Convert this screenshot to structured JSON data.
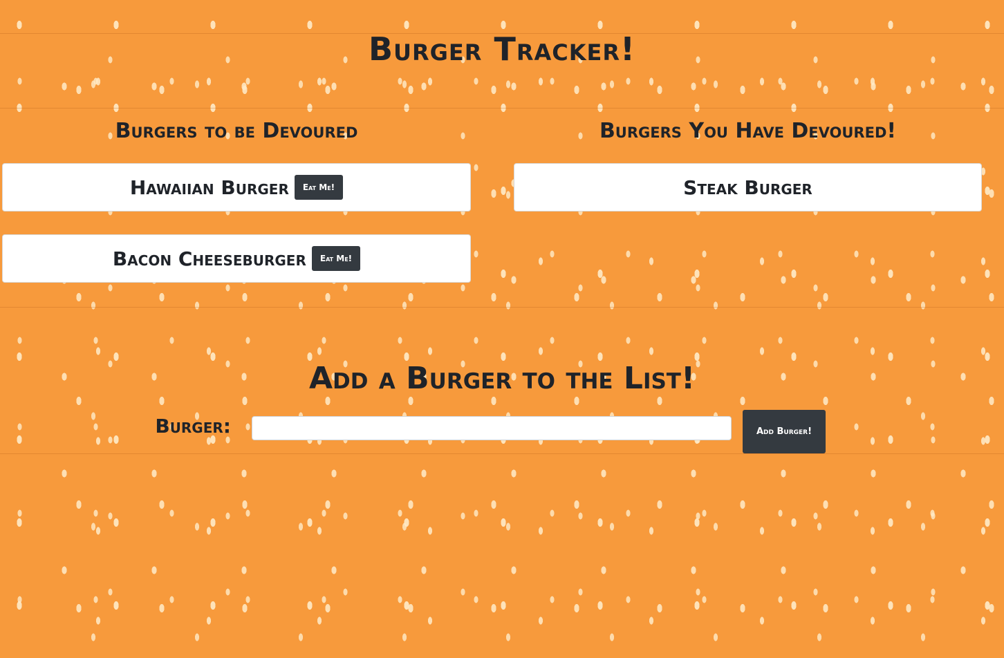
{
  "header": {
    "title": "Burger Tracker!"
  },
  "to_devour": {
    "heading": "Burgers to be Devoured",
    "items": [
      {
        "name": "Hawaiian Burger",
        "button_label": "Eat Me!"
      },
      {
        "name": "Bacon Cheeseburger",
        "button_label": "Eat Me!"
      }
    ]
  },
  "devoured": {
    "heading": "Burgers You Have Devoured!",
    "items": [
      {
        "name": "Steak Burger"
      }
    ]
  },
  "add_form": {
    "heading": "Add a Burger to the List!",
    "label": "Burger:",
    "input_value": "",
    "submit_label": "Add Burger!"
  },
  "colors": {
    "background": "#f79a3c",
    "button": "#343a40",
    "text": "#1f2329",
    "card": "#ffffff"
  }
}
